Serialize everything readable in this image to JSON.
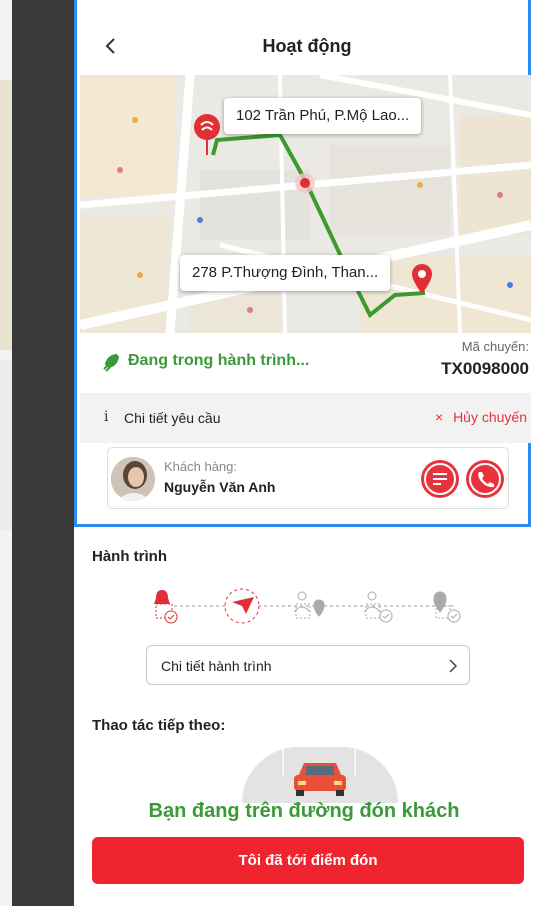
{
  "header": {
    "title": "Hoạt động"
  },
  "map": {
    "pickup_address": "102 Trần Phú, P.Mộ Lao...",
    "dropoff_address": "278 P.Thượng Đình, Than..."
  },
  "status": {
    "text": "Đang trong hành trình...",
    "trip_label": "Mã chuyến:",
    "trip_code": "TX0098000"
  },
  "request": {
    "info_glyph": "i",
    "detail_label": "Chi tiết yêu cầu",
    "cancel_label": "Hủy chuyến",
    "cancel_glyph": "×"
  },
  "customer": {
    "label": "Khách hàng:",
    "name": "Nguyễn Văn Anh"
  },
  "journey": {
    "title": "Hành trình",
    "detail_button": "Chi tiết hành trình"
  },
  "next": {
    "title": "Thao tác tiếp theo:",
    "message": "Bạn đang trên đường đón khách",
    "button": "Tôi đã tới điểm đón"
  },
  "colors": {
    "accent_red": "#f0242e",
    "status_green": "#3a9a3a",
    "border_blue": "#2b8cf3"
  },
  "icons": [
    "back-icon",
    "rocket-icon",
    "info-icon",
    "close-icon",
    "chat-icon",
    "phone-icon",
    "chevron-right-icon",
    "car-icon",
    "map-pin-icon"
  ]
}
